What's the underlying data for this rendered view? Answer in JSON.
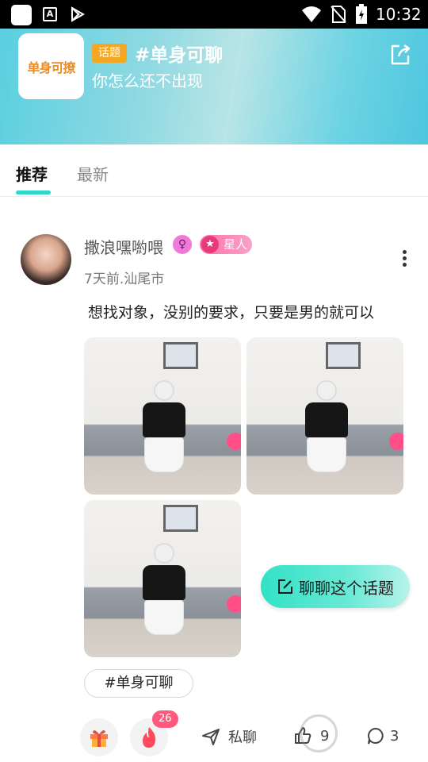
{
  "status_bar": {
    "time": "10:32",
    "icons": [
      "app-square-icon",
      "a-icon",
      "play-store-icon",
      "wifi-icon",
      "no-sim-icon",
      "battery-charging-icon"
    ]
  },
  "topic": {
    "logo_text": "单身可撩",
    "badge": "话题",
    "title": "#单身可聊",
    "subtitle": "你怎么还不出现",
    "share_icon": "share-icon"
  },
  "tabs": [
    {
      "label": "推荐",
      "active": true
    },
    {
      "label": "最新",
      "active": false
    }
  ],
  "post": {
    "username": "撒浪嘿喲喂",
    "gender_icon": "female-icon",
    "star_badge": "星人",
    "meta": "7天前.汕尾市",
    "text": "想找对象，没别的要求，只要是男的就可以",
    "tag": "#单身可聊"
  },
  "floating_button": {
    "label": "聊聊这个话题"
  },
  "actions": {
    "fire_count": "26",
    "dm_label": "私聊",
    "like_count": "9",
    "comment_count": "3"
  },
  "colors": {
    "accent": "#2fd8c8",
    "topic_badge": "#f5a623",
    "star_badge": "#ff6fa7",
    "fire_count": "#ff5a7e"
  }
}
